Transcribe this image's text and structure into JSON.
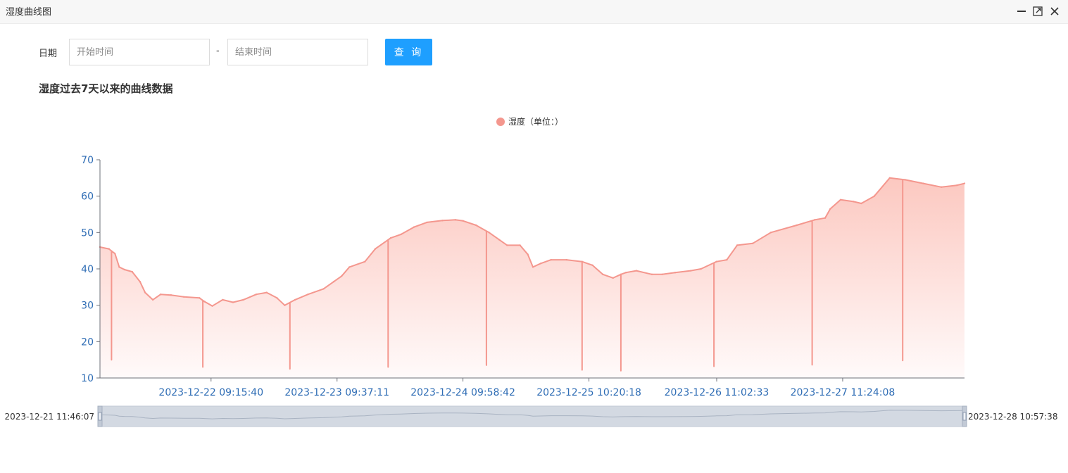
{
  "window": {
    "title": "湿度曲线图"
  },
  "icons": {
    "minimize": "minimize-icon",
    "maximize": "maximize-icon",
    "close": "close-icon"
  },
  "filter": {
    "date_label": "日期",
    "start_placeholder": "开始时间",
    "start_value": "",
    "separator": "-",
    "end_placeholder": "结束时间",
    "end_value": "",
    "query_label": "查 询"
  },
  "colors": {
    "series": "#f4978e",
    "area_top": "#fcc8c0",
    "axis_label": "#2f6db5",
    "query_button": "#1e9fff"
  },
  "chart_data": {
    "type": "area",
    "title": "湿度过去7天以来的曲线数据",
    "legend": {
      "entries": [
        "湿度（单位：）"
      ],
      "position": "top-center"
    },
    "xlabel": "",
    "ylabel": "",
    "ylim": [
      10,
      70
    ],
    "yticks": [
      10,
      20,
      30,
      40,
      50,
      60,
      70
    ],
    "grid": false,
    "x_range": [
      "2023-12-21 11:46:07",
      "2023-12-28 10:57:38"
    ],
    "xticks": [
      "2023-12-22 09:15:40",
      "2023-12-23 09:37:11",
      "2023-12-24 09:58:42",
      "2023-12-25 10:20:18",
      "2023-12-26 11:02:33",
      "2023-12-27 11:24:08"
    ],
    "series": [
      {
        "name": "湿度（单位：）",
        "points": [
          [
            "2023-12-21 11:46",
            46.0
          ],
          [
            "2023-12-21 13:30",
            45.5
          ],
          [
            "2023-12-21 14:40",
            44.2
          ],
          [
            "2023-12-21 15:30",
            40.5
          ],
          [
            "2023-12-21 16:30",
            39.8
          ],
          [
            "2023-12-21 18:00",
            39.2
          ],
          [
            "2023-12-21 19:30",
            36.5
          ],
          [
            "2023-12-21 20:30",
            33.5
          ],
          [
            "2023-12-21 22:00",
            31.5
          ],
          [
            "2023-12-21 23:30",
            33.0
          ],
          [
            "2023-12-22 01:30",
            32.8
          ],
          [
            "2023-12-22 04:00",
            32.3
          ],
          [
            "2023-12-22 07:00",
            32.0
          ],
          [
            "2023-12-22 08:00",
            31.0
          ],
          [
            "2023-12-22 09:30",
            29.8
          ],
          [
            "2023-12-22 11:30",
            31.5
          ],
          [
            "2023-12-22 13:30",
            30.8
          ],
          [
            "2023-12-22 15:30",
            31.5
          ],
          [
            "2023-12-22 18:00",
            33.0
          ],
          [
            "2023-12-22 20:00",
            33.5
          ],
          [
            "2023-12-22 22:00",
            32.0
          ],
          [
            "2023-12-22 23:30",
            30.0
          ],
          [
            "2023-12-23 01:30",
            31.5
          ],
          [
            "2023-12-23 04:00",
            33.0
          ],
          [
            "2023-12-23 07:00",
            34.5
          ],
          [
            "2023-12-23 09:00",
            36.5
          ],
          [
            "2023-12-23 10:30",
            38.0
          ],
          [
            "2023-12-23 12:00",
            40.5
          ],
          [
            "2023-12-23 15:00",
            42.0
          ],
          [
            "2023-12-23 17:00",
            45.5
          ],
          [
            "2023-12-23 20:00",
            48.5
          ],
          [
            "2023-12-23 22:00",
            49.5
          ],
          [
            "2023-12-24 00:30",
            51.5
          ],
          [
            "2023-12-24 03:00",
            52.8
          ],
          [
            "2023-12-24 06:00",
            53.3
          ],
          [
            "2023-12-24 08:30",
            53.5
          ],
          [
            "2023-12-24 10:00",
            53.2
          ],
          [
            "2023-12-24 12:30",
            52.0
          ],
          [
            "2023-12-24 15:00",
            50.0
          ],
          [
            "2023-12-24 17:00",
            48.0
          ],
          [
            "2023-12-24 18:30",
            46.5
          ],
          [
            "2023-12-24 21:00",
            46.5
          ],
          [
            "2023-12-24 22:30",
            44.0
          ],
          [
            "2023-12-24 23:30",
            40.5
          ],
          [
            "2023-12-25 01:00",
            41.5
          ],
          [
            "2023-12-25 03:00",
            42.5
          ],
          [
            "2023-12-25 06:00",
            42.5
          ],
          [
            "2023-12-25 09:00",
            42.0
          ],
          [
            "2023-12-25 11:00",
            41.0
          ],
          [
            "2023-12-25 13:00",
            38.5
          ],
          [
            "2023-12-25 15:00",
            37.5
          ],
          [
            "2023-12-25 16:30",
            38.5
          ],
          [
            "2023-12-25 17:30",
            39.0
          ],
          [
            "2023-12-25 19:30",
            39.5
          ],
          [
            "2023-12-25 22:30",
            38.5
          ],
          [
            "2023-12-26 00:30",
            38.5
          ],
          [
            "2023-12-26 03:00",
            39.0
          ],
          [
            "2023-12-26 06:00",
            39.5
          ],
          [
            "2023-12-26 08:00",
            40.0
          ],
          [
            "2023-12-26 11:00",
            42.0
          ],
          [
            "2023-12-26 13:00",
            42.5
          ],
          [
            "2023-12-26 15:00",
            46.5
          ],
          [
            "2023-12-26 18:00",
            47.0
          ],
          [
            "2023-12-26 21:30",
            50.0
          ],
          [
            "2023-12-27 02:30",
            52.0
          ],
          [
            "2023-12-27 06:00",
            53.5
          ],
          [
            "2023-12-27 08:00",
            54.0
          ],
          [
            "2023-12-27 09:00",
            56.5
          ],
          [
            "2023-12-27 11:00",
            59.0
          ],
          [
            "2023-12-27 13:30",
            58.5
          ],
          [
            "2023-12-27 15:00",
            58.0
          ],
          [
            "2023-12-27 17:30",
            60.0
          ],
          [
            "2023-12-27 20:30",
            65.0
          ],
          [
            "2023-12-27 23:30",
            64.5
          ],
          [
            "2023-12-28 03:00",
            63.5
          ],
          [
            "2023-12-28 06:30",
            62.5
          ],
          [
            "2023-12-28 09:30",
            63.0
          ],
          [
            "2023-12-28 10:57",
            63.5
          ]
        ],
        "drops": [
          [
            "2023-12-21 14:00",
            15.0
          ],
          [
            "2023-12-22 07:40",
            13.0
          ],
          [
            "2023-12-23 00:30",
            12.5
          ],
          [
            "2023-12-23 19:30",
            13.0
          ],
          [
            "2023-12-24 14:30",
            13.5
          ],
          [
            "2023-12-25 09:00",
            12.2
          ],
          [
            "2023-12-25 16:30",
            12.0
          ],
          [
            "2023-12-26 10:30",
            13.2
          ],
          [
            "2023-12-27 05:30",
            13.6
          ],
          [
            "2023-12-27 23:00",
            14.8
          ]
        ]
      }
    ],
    "data_zoom": {
      "start_label": "2023-12-21 11:46:07",
      "end_label": "2023-12-28 10:57:38",
      "start": 0,
      "end": 1
    }
  }
}
